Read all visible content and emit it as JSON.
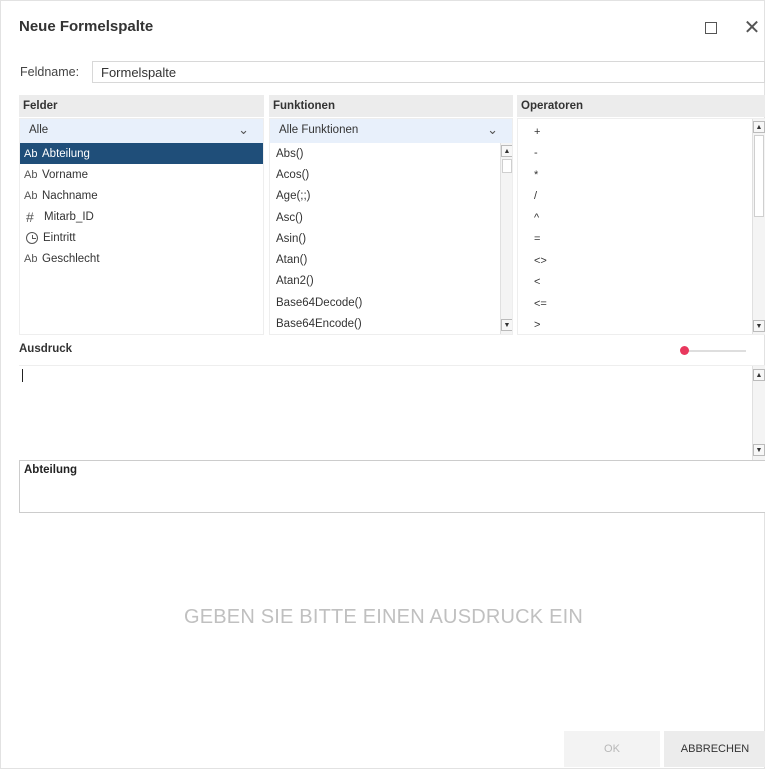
{
  "dialog": {
    "title": "Neue Formelspalte",
    "maximize_icon": "maximize-icon",
    "close_icon": "close-icon",
    "close_glyph": "✕"
  },
  "fieldname": {
    "label": "Feldname:",
    "value": "Formelspalte"
  },
  "felder": {
    "header": "Felder",
    "filter": "Alle",
    "items": [
      {
        "icon": "Ab",
        "icon_name": "text-type-icon",
        "label": "Abteilung",
        "selected": true
      },
      {
        "icon": "Ab",
        "icon_name": "text-type-icon",
        "label": "Vorname",
        "selected": false
      },
      {
        "icon": "Ab",
        "icon_name": "text-type-icon",
        "label": "Nachname",
        "selected": false
      },
      {
        "icon": "#",
        "icon_name": "number-type-icon",
        "label": "Mitarb_ID",
        "selected": false
      },
      {
        "icon": "",
        "icon_name": "datetime-type-icon",
        "label": "Eintritt",
        "selected": false
      },
      {
        "icon": "Ab",
        "icon_name": "text-type-icon",
        "label": "Geschlecht",
        "selected": false
      }
    ]
  },
  "funktionen": {
    "header": "Funktionen",
    "filter": "Alle Funktionen",
    "items": [
      "Abs()",
      "Acos()",
      "Age(;;)",
      "Asc()",
      "Asin()",
      "Atan()",
      "Atan2()",
      "Base64Decode()",
      "Base64Encode()"
    ]
  },
  "operatoren": {
    "header": "Operatoren",
    "items": [
      "+",
      "-",
      "*",
      "/",
      "^",
      "=",
      "<>",
      "<",
      "<=",
      ">"
    ]
  },
  "ausdruck": {
    "header": "Ausdruck",
    "value": "",
    "zoom_level": 0.0
  },
  "description": {
    "title": "Abteilung"
  },
  "message": "GEBEN SIE BITTE EINEN AUSDRUCK EIN",
  "buttons": {
    "ok": "OK",
    "cancel": "ABBRECHEN"
  },
  "colors": {
    "selection": "#1f4e79",
    "dropdown_bg": "#e8f0fb",
    "zoom_accent": "#e8385d",
    "panel_header_bg": "#ececec"
  },
  "icons": {
    "chevron": "chevron-down-icon",
    "scroll_up": "scroll-up-icon",
    "scroll_down": "scroll-down-icon"
  }
}
